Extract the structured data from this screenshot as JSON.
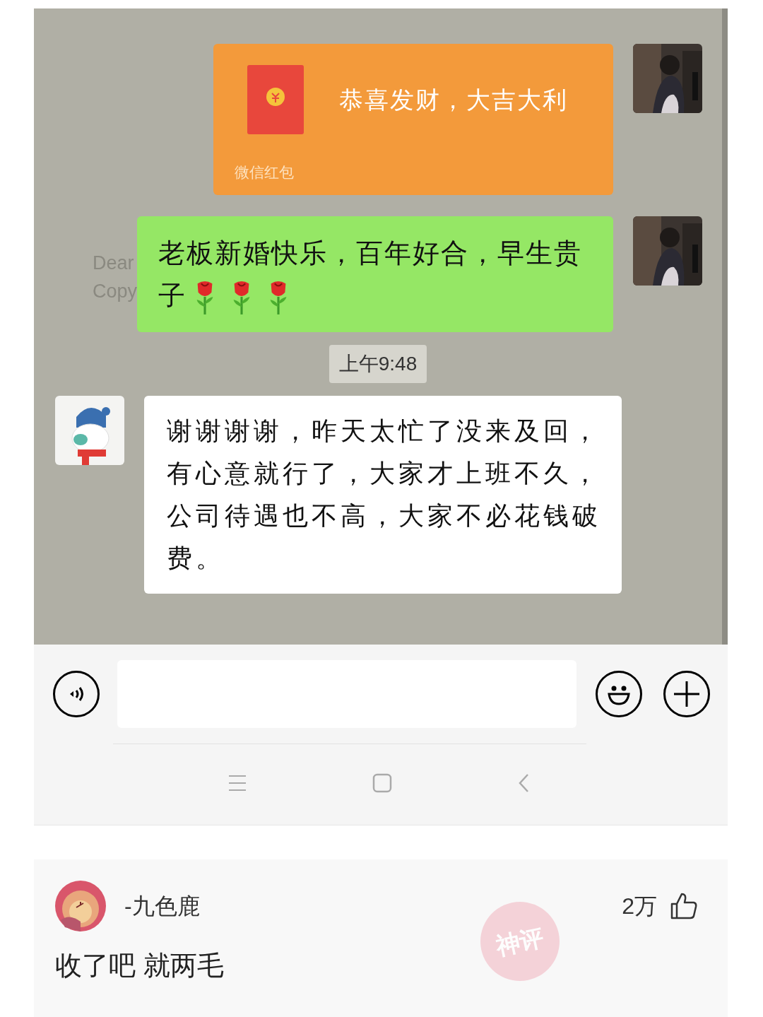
{
  "background_text": [
    "Dear",
    "Copy"
  ],
  "messages": [
    {
      "kind": "red_packet",
      "outgoing": true,
      "text": "恭喜发财，大吉大利",
      "label": "微信红包"
    },
    {
      "kind": "text",
      "outgoing": true,
      "text": "老板新婚快乐，百年好合，早生贵子",
      "emojis": [
        {
          "kind": "rose"
        },
        {
          "kind": "rose"
        },
        {
          "kind": "rose"
        }
      ]
    },
    {
      "kind": "time",
      "text": "上午9:48"
    },
    {
      "kind": "text",
      "outgoing": false,
      "text": "谢谢谢谢，昨天太忙了没来及回，有心意就行了，大家才上班不久，公司待遇也不高，大家不必花钱破费。"
    }
  ],
  "comment": {
    "user": "-九色鹿",
    "likes": "2万",
    "badge": "神评",
    "text": "收了吧 就两毛"
  }
}
